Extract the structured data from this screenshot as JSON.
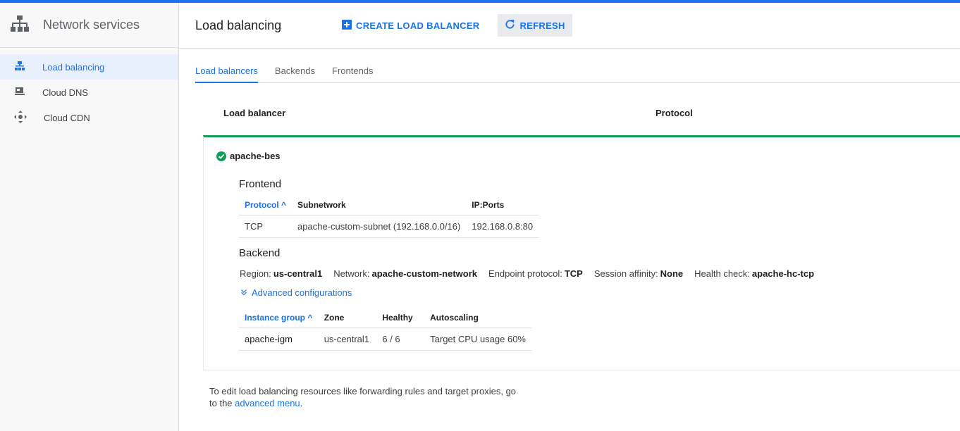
{
  "sidebar": {
    "title": "Network services",
    "items": [
      {
        "label": "Load balancing",
        "icon": "load-balancing-icon",
        "active": true
      },
      {
        "label": "Cloud DNS",
        "icon": "dns-icon"
      },
      {
        "label": "Cloud CDN",
        "icon": "cdn-icon"
      }
    ]
  },
  "header": {
    "title": "Load balancing",
    "create_label": "CREATE LOAD BALANCER",
    "refresh_label": "REFRESH"
  },
  "tabs": [
    "Load balancers",
    "Backends",
    "Frontends"
  ],
  "columns": {
    "load_balancer": "Load balancer",
    "protocol": "Protocol"
  },
  "load_balancer": {
    "name": "apache-bes",
    "status": "healthy",
    "frontend": {
      "title": "Frontend",
      "headers": [
        "Protocol",
        "Subnetwork",
        "IP:Ports"
      ],
      "rows": [
        [
          "TCP",
          "apache-custom-subnet (192.168.0.0/16)",
          "192.168.0.8:80"
        ]
      ]
    },
    "backend": {
      "title": "Backend",
      "region_label": "Region:",
      "region": "us-central1",
      "network_label": "Network:",
      "network": "apache-custom-network",
      "endpoint_label": "Endpoint protocol:",
      "endpoint": "TCP",
      "affinity_label": "Session affinity:",
      "affinity": "None",
      "health_label": "Health check:",
      "health": "apache-hc-tcp",
      "advanced_label": "Advanced configurations",
      "headers": [
        "Instance group",
        "Zone",
        "Healthy",
        "Autoscaling"
      ],
      "rows": [
        [
          "apache-igm",
          "us-central1",
          "6 / 6",
          "Target CPU usage 60%"
        ]
      ]
    }
  },
  "footer": {
    "text": "To edit load balancing resources like forwarding rules and target proxies, go to the",
    "link": "advanced menu",
    "end": "."
  },
  "colors": {
    "accent": "#1a73e8",
    "success": "#0f9d58"
  }
}
